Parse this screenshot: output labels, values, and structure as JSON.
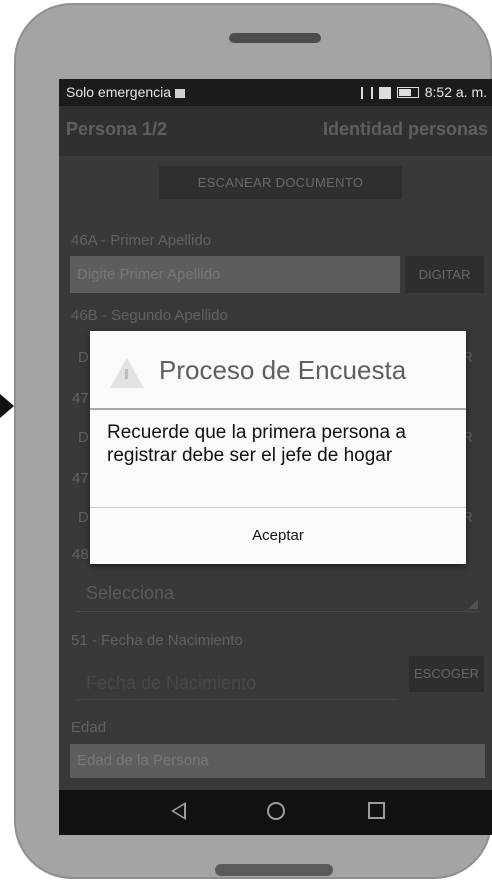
{
  "status_bar": {
    "carrier": "Solo emergencia",
    "time": "8:52 a. m."
  },
  "app_bar": {
    "left_title": "Persona 1/2",
    "right_title": "Identidad personas"
  },
  "scan_button": "ESCANEAR DOCUMENTO",
  "form": {
    "first_surname": {
      "label": "46A - Primer Apellido",
      "placeholder": "Digite Primer Apellido",
      "button": "DIGITAR"
    },
    "second_surname": {
      "label": "46B - Segundo Apellido"
    },
    "behind_dialog_fragments": [
      "D",
      "R",
      "47",
      "D",
      "R",
      "47",
      "D",
      "R",
      "48"
    ],
    "select": {
      "value": "Selecciona"
    },
    "birth_date": {
      "label": "51 - Fecha de Nacimiento",
      "placeholder": "Fecha de Nacimiento",
      "button": "ESCOGER"
    },
    "age": {
      "label": "Edad",
      "placeholder": "Edad de la Persona"
    }
  },
  "dialog": {
    "title": "Proceso de Encuesta",
    "message": "Recuerde que la primera persona a registrar debe ser el jefe de hogar",
    "button": "Aceptar"
  },
  "icons": [
    "warning-icon",
    "back-icon",
    "home-icon",
    "recents-icon",
    "battery-icon"
  ]
}
